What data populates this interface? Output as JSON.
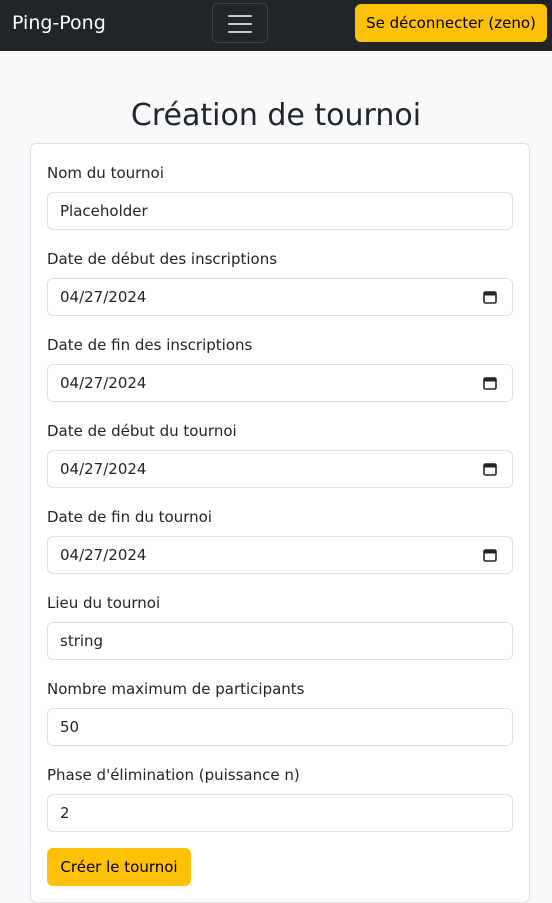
{
  "navbar": {
    "brand": "Ping-Pong",
    "logout_label": "Se déconnecter (zeno)"
  },
  "page": {
    "title": "Création de tournoi"
  },
  "form": {
    "fields": [
      {
        "label": "Nom du tournoi",
        "value": "Placeholder",
        "type": "text"
      },
      {
        "label": "Date de début des inscriptions",
        "value": "04/27/2024",
        "type": "date"
      },
      {
        "label": "Date de fin des inscriptions",
        "value": "04/27/2024",
        "type": "date"
      },
      {
        "label": "Date de début du tournoi",
        "value": "04/27/2024",
        "type": "date"
      },
      {
        "label": "Date de fin du tournoi",
        "value": "04/27/2024",
        "type": "date"
      },
      {
        "label": "Lieu du tournoi",
        "value": "string",
        "type": "text"
      },
      {
        "label": "Nombre maximum de participants",
        "value": "50",
        "type": "number"
      },
      {
        "label": "Phase d'élimination (puissance n)",
        "value": "2",
        "type": "number"
      }
    ],
    "submit_label": "Créer le tournoi"
  },
  "colors": {
    "navbar_bg": "#212529",
    "accent": "#ffc107",
    "page_bg": "#f8f9fa",
    "border": "#dee2e6"
  },
  "icons": {
    "menu": "hamburger-menu-icon",
    "date": "calendar-icon"
  }
}
